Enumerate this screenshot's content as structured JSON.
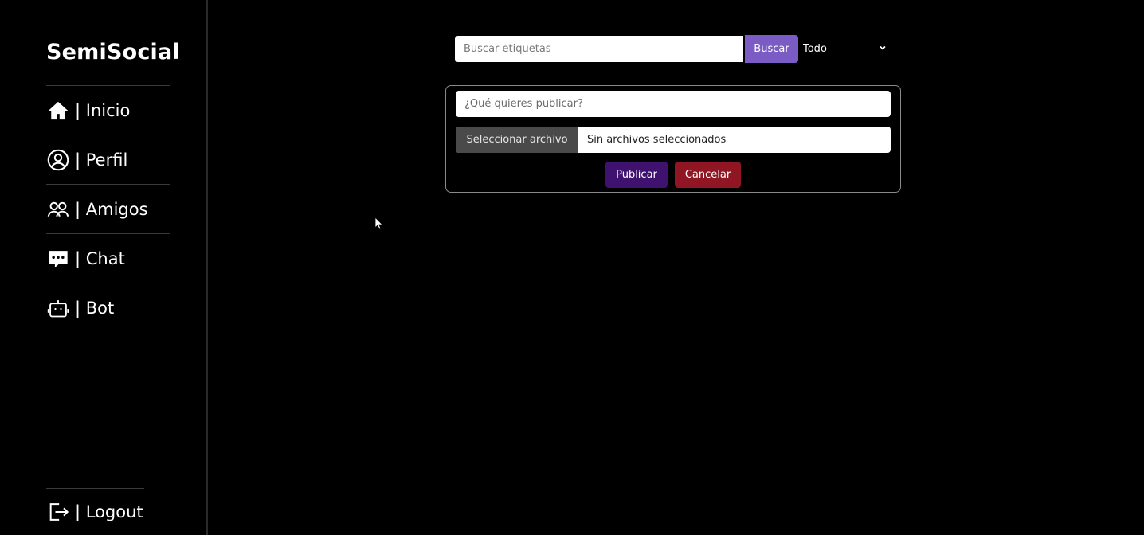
{
  "brand": "SemiSocial",
  "nav": {
    "items": [
      {
        "label": "| Inicio",
        "icon": "home-icon"
      },
      {
        "label": "| Perfil",
        "icon": "user-circle-icon"
      },
      {
        "label": "| Amigos",
        "icon": "users-icon"
      },
      {
        "label": "| Chat",
        "icon": "chat-icon"
      },
      {
        "label": "| Bot",
        "icon": "robot-icon"
      }
    ],
    "logout": {
      "label": "| Logout",
      "icon": "logout-icon"
    }
  },
  "search": {
    "placeholder": "Buscar etiquetas",
    "button_label": "Buscar",
    "filter_value": "Todo"
  },
  "post": {
    "placeholder": "¿Qué quieres publicar?",
    "file_button_label": "Seleccionar archivo",
    "file_status": "Sin archivos seleccionados",
    "publish_label": "Publicar",
    "cancel_label": "Cancelar"
  },
  "colors": {
    "background": "#000000",
    "search_button": "#7b5cc4",
    "publish_button": "#3f1270",
    "cancel_button": "#8f1622"
  }
}
